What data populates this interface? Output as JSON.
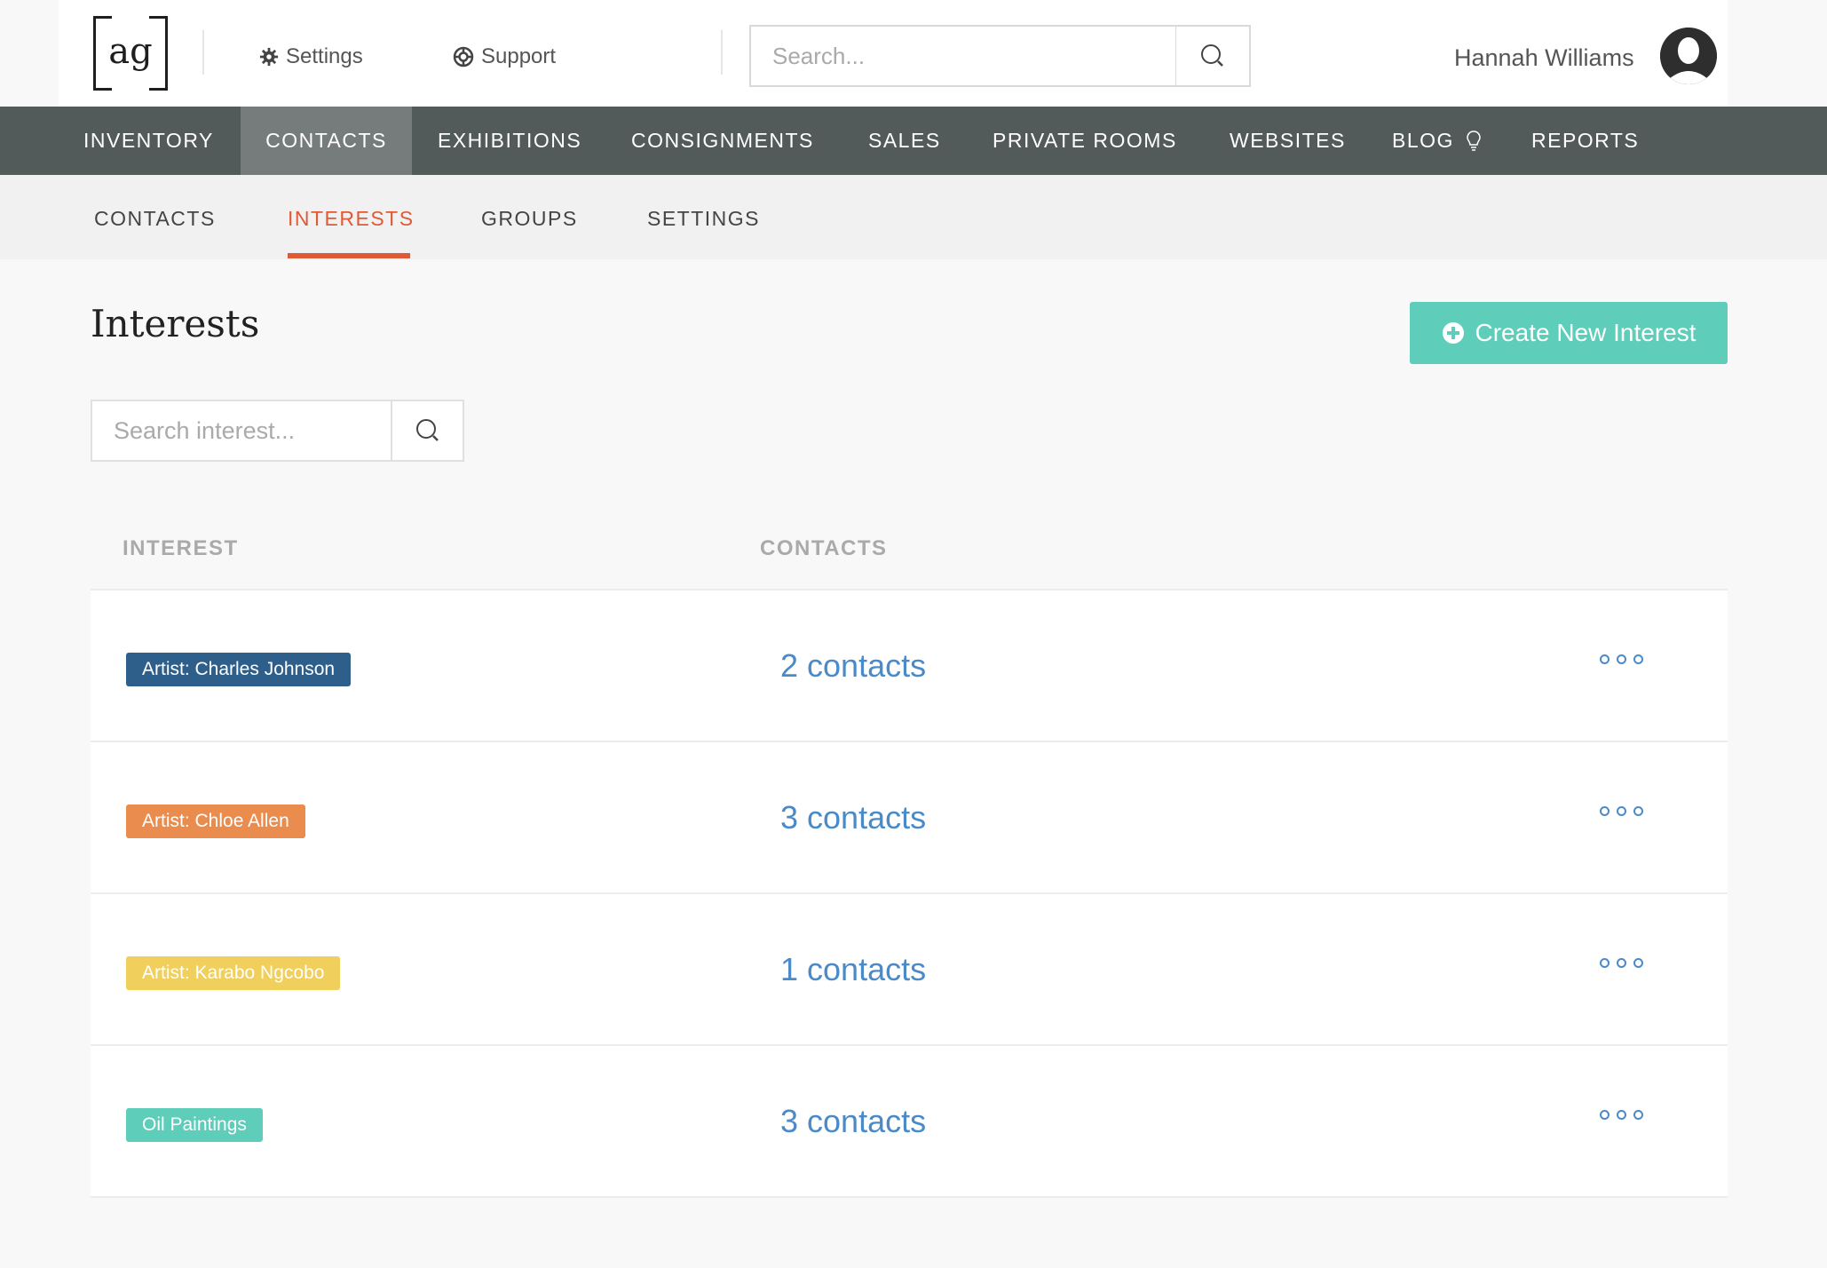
{
  "header": {
    "logo_text": "ag",
    "settings_label": "Settings",
    "support_label": "Support",
    "search_placeholder": "Search...",
    "user_name": "Hannah Williams"
  },
  "main_nav": {
    "items": [
      {
        "label": "INVENTORY"
      },
      {
        "label": "CONTACTS"
      },
      {
        "label": "EXHIBITIONS"
      },
      {
        "label": "CONSIGNMENTS"
      },
      {
        "label": "SALES"
      },
      {
        "label": "PRIVATE ROOMS"
      },
      {
        "label": "WEBSITES"
      },
      {
        "label": "BLOG"
      },
      {
        "label": "REPORTS"
      }
    ],
    "active": "CONTACTS"
  },
  "sub_nav": {
    "items": [
      {
        "label": "CONTACTS"
      },
      {
        "label": "INTERESTS"
      },
      {
        "label": "GROUPS"
      },
      {
        "label": "SETTINGS"
      }
    ],
    "active": "INTERESTS"
  },
  "page": {
    "title": "Interests",
    "create_button_label": "Create New Interest",
    "search_placeholder": "Search interest..."
  },
  "table": {
    "columns": [
      "INTEREST",
      "CONTACTS"
    ],
    "rows": [
      {
        "interest": "Artist: Charles Johnson",
        "tag_color": "#2e5e8a",
        "contacts": "2 contacts"
      },
      {
        "interest": "Artist: Chloe Allen",
        "tag_color": "#e98c4d",
        "contacts": "3 contacts"
      },
      {
        "interest": "Artist: Karabo Ngcobo",
        "tag_color": "#f0cf5c",
        "contacts": "1 contacts"
      },
      {
        "interest": "Oil Paintings",
        "tag_color": "#5ecdb9",
        "contacts": "3 contacts"
      }
    ]
  },
  "colors": {
    "accent": "#e05a35",
    "primary_button": "#5ecdb9",
    "link": "#4a8ac9",
    "nav_bg": "#525a5a"
  }
}
